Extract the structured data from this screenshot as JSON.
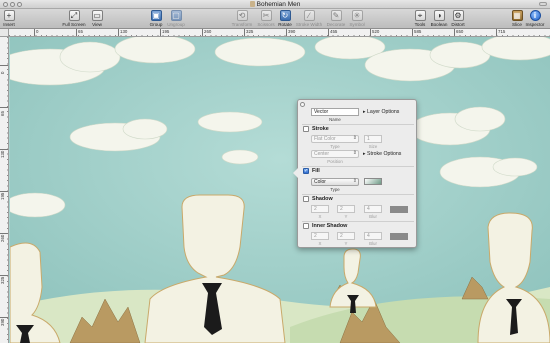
{
  "window": {
    "title": "Bohemian Men"
  },
  "toolbar": {
    "items": [
      {
        "label": "Insert",
        "icon": "plus-icon",
        "glyph": "+"
      },
      {
        "label": "Full Screen",
        "icon": "fullscreen-icon",
        "glyph": "⤢"
      },
      {
        "label": "View",
        "icon": "view-icon",
        "glyph": "▭"
      },
      {
        "label": "Group",
        "icon": "group-icon",
        "glyph": "▣"
      },
      {
        "label": "Ungroup",
        "icon": "ungroup-icon",
        "glyph": "▢"
      },
      {
        "label": "Transform",
        "icon": "transform-icon",
        "glyph": "⟲"
      },
      {
        "label": "Scissors",
        "icon": "scissors-icon",
        "glyph": "✂"
      },
      {
        "label": "Rotate",
        "icon": "rotate-icon",
        "glyph": "↻"
      },
      {
        "label": "Stroke Width",
        "icon": "stroke-width-icon",
        "glyph": "∕"
      },
      {
        "label": "Decorate",
        "icon": "decorate-icon",
        "glyph": "✎"
      },
      {
        "label": "Symbol",
        "icon": "symbol-icon",
        "glyph": "✳"
      },
      {
        "label": "Tools",
        "icon": "tools-icon",
        "glyph": "⌖"
      },
      {
        "label": "Boolean",
        "icon": "boolean-icon",
        "glyph": "◑"
      },
      {
        "label": "Distort",
        "icon": "distort-icon",
        "glyph": "⚙"
      },
      {
        "label": "Slice",
        "icon": "slice-icon",
        "glyph": "▦"
      },
      {
        "label": "Inspector",
        "icon": "info-icon",
        "glyph": "i"
      }
    ]
  },
  "ruler": {
    "horizontal": [
      "0",
      "65",
      "130",
      "195",
      "260",
      "325",
      "390",
      "455",
      "520",
      "585",
      "650",
      "715"
    ],
    "vertical": [
      "0",
      "65",
      "130",
      "195",
      "260",
      "325",
      "390"
    ]
  },
  "inspector": {
    "name_value": "Vector",
    "name_caption": "Name",
    "layer_options": "Layer Options",
    "stroke": {
      "label": "Stroke",
      "type_value": "Flat Color",
      "type_caption": "Type",
      "size_value": "1",
      "size_caption": "Size",
      "position_value": "Center",
      "position_caption": "Position",
      "stroke_options": "Stroke Options"
    },
    "fill": {
      "label": "Fill",
      "type_value": "Color",
      "type_caption": "Type",
      "swatch_color": "#6e9a86"
    },
    "shadow": {
      "label": "Shadow",
      "x": "2",
      "y": "2",
      "blur": "4",
      "x_caption": "X",
      "y_caption": "Y",
      "blur_caption": "Blur",
      "swatch_color": "#8a8a8a"
    },
    "inner_shadow": {
      "label": "Inner Shadow",
      "x": "2",
      "y": "2",
      "blur": "4",
      "x_caption": "X",
      "y_caption": "Y",
      "blur_caption": "Blur",
      "swatch_color": "#8a8a8a"
    }
  },
  "colors": {
    "sky": "#a9d3cf",
    "cloud": "#f4f5ec",
    "figure": "#f3f2e3",
    "figure_outline": "#c9a96a",
    "tie": "#1b1b1b",
    "hill": "#d9e7c5",
    "rock": "#b99a62"
  }
}
